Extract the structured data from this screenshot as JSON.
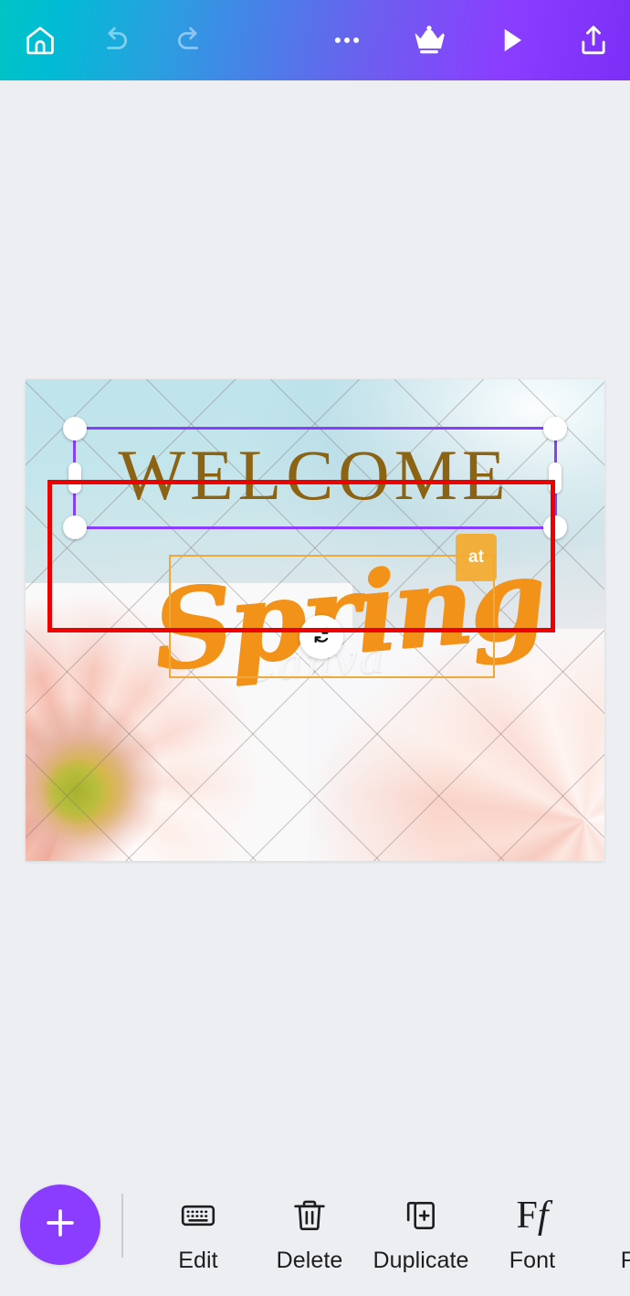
{
  "app": {
    "name": "Canva",
    "screen": "design-editor"
  },
  "topbar": {
    "gradient_from": "#00c4c4",
    "gradient_to": "#7b2ff7",
    "left_actions": [
      {
        "name": "home",
        "icon": "home-icon",
        "label": "Home"
      },
      {
        "name": "undo",
        "icon": "undo-icon",
        "label": "Undo"
      },
      {
        "name": "redo",
        "icon": "redo-icon",
        "label": "Redo"
      }
    ],
    "right_actions": [
      {
        "name": "more",
        "icon": "more-horizontal-icon",
        "label": "More"
      },
      {
        "name": "pro",
        "icon": "crown-icon",
        "label": "Pro"
      },
      {
        "name": "present",
        "icon": "play-icon",
        "label": "Present"
      },
      {
        "name": "share",
        "icon": "share-upload-icon",
        "label": "Share"
      }
    ]
  },
  "canvas": {
    "background_color": "#eceef1",
    "design": {
      "headline": "WELCOME",
      "headline_color": "#8c6213",
      "script_word": "Spring",
      "script_color": "#f29219",
      "watermark": "Canva",
      "badge_label": "at"
    },
    "selection": {
      "active_element": "WELCOME",
      "frame_color": "#8b3dff",
      "secondary_frame_color": "#efa93a",
      "rotate_handle_icon": "rotate-icon",
      "handles": [
        "top-left",
        "top-right",
        "bottom-left",
        "bottom-right",
        "left-mid",
        "right-mid"
      ]
    },
    "annotation": {
      "shape": "rectangle",
      "color": "#ee0000",
      "target": "WELCOME"
    }
  },
  "bottombar": {
    "add_button": {
      "icon": "plus-icon",
      "label": "Add"
    },
    "tools": [
      {
        "label": "Edit",
        "icon": "keyboard-icon"
      },
      {
        "label": "Delete",
        "icon": "trash-icon"
      },
      {
        "label": "Duplicate",
        "icon": "duplicate-icon"
      },
      {
        "label": "Font",
        "icon": "font-ff-icon"
      },
      {
        "label": "Font",
        "icon": "font-size-a-icon"
      }
    ]
  }
}
